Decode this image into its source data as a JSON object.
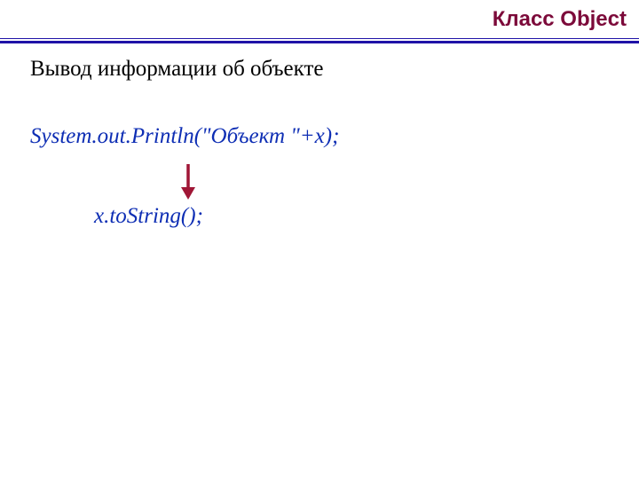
{
  "header": {
    "title": "Класс Object"
  },
  "body": {
    "subtitle": "Вывод информации об объекте",
    "code_line1": "System.out.Println(\"Объект \"+x);",
    "code_line2": "x.toString();"
  },
  "colors": {
    "header_text": "#7c0a3a",
    "rule": "#1f12a7",
    "code_text": "#0e2eb4",
    "arrow": "#a01636"
  }
}
